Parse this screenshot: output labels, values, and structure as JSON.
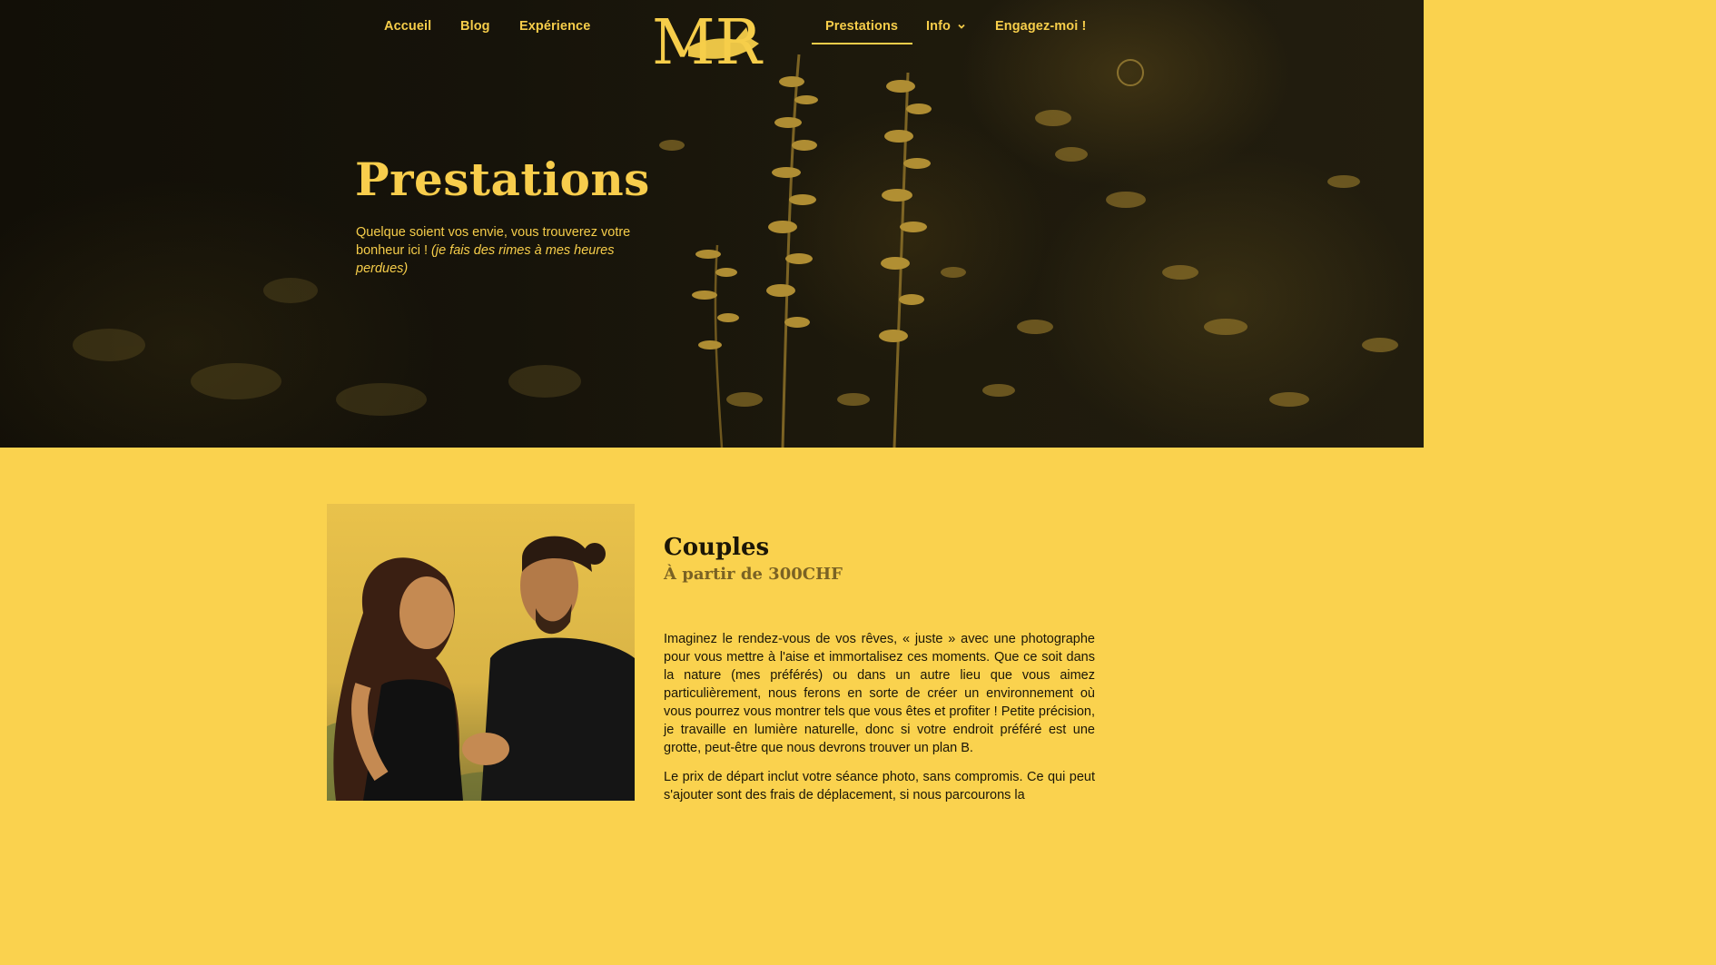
{
  "nav": {
    "left_items": [
      {
        "label": "Accueil"
      },
      {
        "label": "Blog"
      },
      {
        "label": "Expérience"
      }
    ],
    "right_items": [
      {
        "label": "Prestations",
        "active": true
      },
      {
        "label": "Info",
        "has_dropdown": true
      },
      {
        "label": "Engagez-moi !"
      }
    ],
    "logo_text": "MR"
  },
  "hero": {
    "title": "Prestations",
    "subtitle": "Quelque soient vos envie, vous trouverez votre bonheur ici !",
    "subtitle_italic": "(je fais des rimes à mes heures perdues)"
  },
  "section": {
    "title": "Couples",
    "price": "À partir de 300CHF",
    "paragraph_1": "Imaginez le rendez-vous de vos rêves, « juste » avec une photographe pour vous mettre à l'aise et immortalisez ces moments. Que ce soit dans la nature (mes préférés) ou dans un autre lieu que vous aimez particulièrement, nous ferons en sorte de créer un environnement où vous pourrez vous montrer tels que vous êtes et profiter ! Petite précision, je travaille en lumière naturelle, donc si votre endroit préféré est une grotte, peut-être que nous devrons trouver un plan B.",
    "paragraph_2": "Le prix de départ inclut votre séance photo, sans compromis. Ce qui peut s'ajouter sont des frais de déplacement, si nous parcourons la"
  },
  "colors": {
    "accent_yellow": "#f8cd4c",
    "background_yellow": "#fad24e",
    "hero_dark": "#16130a",
    "text_dark": "#1b1607",
    "price_brown": "#7a6224"
  },
  "icons": [
    "chevron-down-icon",
    "fox-logo-icon"
  ]
}
